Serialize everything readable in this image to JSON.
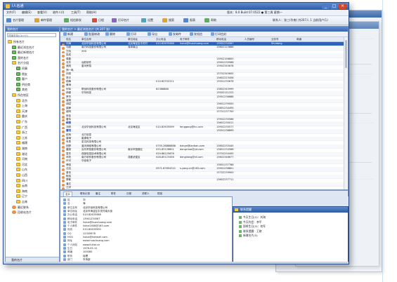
{
  "window": {
    "title": "Ⅰ人名通",
    "controls": {
      "minimize": "_",
      "maximize": "□",
      "close": "×"
    }
  },
  "menu": {
    "items": [
      "文件(F)",
      "编辑(E)",
      "查看(V)",
      "收件人(I)",
      "工具(T)",
      "帮助(H)"
    ],
    "clock": "版本：8.0 Build 07.0522  ● 第三周 星期一"
  },
  "toolbar": {
    "buttons": [
      {
        "label": "名片管理",
        "icon": "card-icon",
        "color": "#4f86d6"
      },
      {
        "label": "邮件管理",
        "icon": "mail-icon",
        "color": "#e0a23a"
      },
      {
        "label": "短信群发",
        "icon": "sms-icon",
        "color": "#5fae5b"
      },
      {
        "label": "日程",
        "icon": "calendar-icon",
        "color": "#d0503d"
      },
      {
        "label": "打印名片",
        "icon": "print-icon",
        "color": "#8a63c2"
      },
      {
        "label": "设置",
        "icon": "settings-icon",
        "color": "#4aa7b7"
      },
      {
        "label": "搜索",
        "icon": "search-icon",
        "color": "#e0a23a"
      },
      {
        "label": "报表",
        "icon": "report-icon",
        "color": "#4f86d6"
      },
      {
        "label": "帮助",
        "icon": "help-icon",
        "color": "#5fae5b"
      }
    ],
    "summary": "联系人：张三(华南) 共207人 1 当前用户(1)"
  },
  "sidebar": {
    "header": "我的名片",
    "filter": "快速查找(Ctrl+F)",
    "tree": [
      {
        "label": "所有名片",
        "level": 0,
        "icon": "folder"
      },
      {
        "label": "最近浏览名片",
        "level": 1,
        "icon": "group"
      },
      {
        "label": "最近新增名片",
        "level": 1,
        "icon": "group"
      },
      {
        "label": "我的名片",
        "level": 1,
        "icon": "group"
      },
      {
        "label": "名片分组",
        "level": 1,
        "icon": "folder"
      },
      {
        "label": "同事",
        "level": 2,
        "icon": "group"
      },
      {
        "label": "朋友",
        "level": 2,
        "icon": "group"
      },
      {
        "label": "客户",
        "level": 2,
        "icon": "group"
      },
      {
        "label": "供应商",
        "level": 2,
        "icon": "group"
      },
      {
        "label": "其他",
        "level": 2,
        "icon": "group"
      },
      {
        "label": "所在地区",
        "level": 1,
        "icon": "folder"
      },
      {
        "label": "北京",
        "level": 2,
        "icon": "folder"
      },
      {
        "label": "上海",
        "level": 2,
        "icon": "folder"
      },
      {
        "label": "天津",
        "level": 2,
        "icon": "folder"
      },
      {
        "label": "重庆",
        "level": 2,
        "icon": "folder"
      },
      {
        "label": "广东",
        "level": 2,
        "icon": "folder"
      },
      {
        "label": "广西",
        "level": 2,
        "icon": "folder"
      },
      {
        "label": "浙江",
        "level": 2,
        "icon": "folder"
      },
      {
        "label": "江苏",
        "level": 2,
        "icon": "folder"
      },
      {
        "label": "福建",
        "level": 2,
        "icon": "folder"
      },
      {
        "label": "湖南",
        "level": 2,
        "icon": "folder"
      },
      {
        "label": "湖北",
        "level": 2,
        "icon": "folder"
      },
      {
        "label": "河南",
        "level": 2,
        "icon": "folder"
      },
      {
        "label": "河北",
        "level": 2,
        "icon": "folder"
      },
      {
        "label": "山东",
        "level": 2,
        "icon": "folder"
      },
      {
        "label": "山西",
        "level": 2,
        "icon": "folder"
      },
      {
        "label": "四川",
        "level": 2,
        "icon": "folder"
      },
      {
        "label": "云南",
        "level": 2,
        "icon": "folder"
      },
      {
        "label": "海南",
        "level": 2,
        "icon": "folder"
      },
      {
        "label": "辽宁",
        "level": 2,
        "icon": "folder"
      },
      {
        "label": "吉林",
        "level": 2,
        "icon": "folder"
      },
      {
        "label": "最近联系",
        "level": 1,
        "icon": "person"
      },
      {
        "label": "回收站名片",
        "level": 1,
        "icon": "person"
      }
    ],
    "footer": "我的名片"
  },
  "list": {
    "header": "我的名片 > 最近浏览名片 (共 207 张)",
    "subtools": [
      "新建",
      "批量修改",
      "删除",
      "打印",
      "导出",
      "发邮件",
      "发短信",
      "打印信封"
    ],
    "columns": [
      "姓名",
      "单位名称",
      "单位地址",
      "办公电话",
      "电子邮件",
      "移动电话",
      "人员编号",
      "业务号",
      "邮编"
    ],
    "rows": [
      {
        "name": "刘海",
        "company": "北京华创科技有限公司",
        "address": "北京海淀区中关村",
        "phone": "010-82635588",
        "email": "liuhai@huachuang.com",
        "mobile": "13901234567",
        "no": "",
        "biz": "Shuitang",
        "zip": "",
        "selected": true
      },
      {
        "name": "马超",
        "company": "南方科技股份有限公司",
        "address": "深圳南山",
        "phone": "",
        "email": "",
        "mobile": "13602123888",
        "no": "",
        "biz": "",
        "zip": ""
      },
      {
        "name": "王晓",
        "company": "XXX",
        "address": "",
        "phone": "",
        "email": "",
        "mobile": "",
        "no": "",
        "biz": "",
        "zip": ""
      },
      {
        "name": "张成",
        "company": "",
        "address": "",
        "phone": "",
        "email": "",
        "mobile": "",
        "no": "",
        "biz": "",
        "zip": ""
      },
      {
        "name": "周磊",
        "company": "",
        "address": "",
        "phone": "",
        "email": "",
        "mobile": "13902156800",
        "no": "",
        "biz": "",
        "zip": ""
      },
      {
        "name": "韦东",
        "company": "远航软件",
        "address": "",
        "phone": "",
        "email": "",
        "mobile": "13901235566",
        "no": "",
        "biz": "",
        "zip": ""
      },
      {
        "name": "吴刚",
        "company": "星河贸易",
        "address": "",
        "phone": "",
        "email": "",
        "mobile": "13902345678",
        "no": "",
        "biz": "",
        "zip": ""
      },
      {
        "name": "郑一鸣",
        "company": "",
        "address": "",
        "phone": "",
        "email": "",
        "mobile": "",
        "no": "",
        "biz": "",
        "zip": ""
      },
      {
        "name": "孙丽",
        "company": "",
        "address": "",
        "phone": "",
        "email": "",
        "mobile": "13702345600",
        "no": "",
        "biz": "",
        "zip": ""
      },
      {
        "name": "李平",
        "company": "",
        "address": "",
        "phone": "",
        "email": "",
        "mobile": "13602223456",
        "no": "",
        "biz": "",
        "zip": ""
      },
      {
        "name": "杨梅",
        "company": "",
        "address": "",
        "phone": "010-62332211",
        "email": "",
        "mobile": "13501235678",
        "no": "",
        "biz": "",
        "zip": ""
      },
      {
        "name": "黄涛",
        "company": "",
        "address": "",
        "phone": "",
        "email": "",
        "mobile": "",
        "no": "",
        "biz": "",
        "zip": ""
      },
      {
        "name": "何军",
        "company": "联创科技股份有限公司",
        "address": "",
        "phone": "62388888",
        "email": "",
        "mobile": "13802345999",
        "no": "",
        "biz": "",
        "zip": ""
      },
      {
        "name": "林峰",
        "company": "华东科技",
        "address": "",
        "phone": "",
        "email": "",
        "mobile": "13502111222",
        "no": "",
        "biz": "",
        "zip": ""
      },
      {
        "name": "罗杰",
        "company": "",
        "address": "",
        "phone": "",
        "email": "",
        "mobile": "13901236688",
        "no": "",
        "biz": "",
        "zip": ""
      },
      {
        "name": "高翔",
        "company": "",
        "address": "",
        "phone": "",
        "email": "",
        "mobile": "",
        "no": "",
        "biz": "",
        "zip": ""
      },
      {
        "name": "胡斌",
        "company": "",
        "address": "",
        "phone": "",
        "email": "",
        "mobile": "13601239000",
        "no": "",
        "biz": "",
        "zip": ""
      },
      {
        "name": "梁静",
        "company": "",
        "address": "",
        "phone": "",
        "email": "",
        "mobile": "13801234455",
        "no": "",
        "biz": "",
        "zip": ""
      },
      {
        "name": "谢明",
        "company": "",
        "address": "",
        "phone": "",
        "email": "",
        "mobile": "13701237700",
        "no": "",
        "biz": "",
        "zip": ""
      },
      {
        "name": "宋佳",
        "company": "",
        "address": "",
        "phone": "",
        "email": "",
        "mobile": "",
        "no": "",
        "biz": "",
        "zip": ""
      },
      {
        "name": "唐伟",
        "company": "",
        "address": "",
        "phone": "",
        "email": "",
        "mobile": "13902235566",
        "no": "",
        "biz": "",
        "zip": ""
      },
      {
        "name": "韩雪",
        "company": "",
        "address": "",
        "phone": "",
        "email": "",
        "mobile": "13601230011",
        "no": "",
        "biz": "",
        "zip": "",
        "highlight": true
      },
      {
        "name": "冯刚",
        "company": "北京华创科技有限公司",
        "address": "北京海淀区",
        "phone": "010-82635599",
        "email": "fenggang@hc.com",
        "mobile": "13902235577",
        "no": "",
        "biz": "",
        "zip": ""
      },
      {
        "name": "曹阳",
        "company": "",
        "address": "",
        "phone": "",
        "email": "",
        "mobile": "13501238899",
        "no": "",
        "biz": "",
        "zip": "",
        "highlight": true
      },
      {
        "name": "彭辉",
        "company": "北方信息",
        "address": "",
        "phone": "",
        "email": "",
        "mobile": "",
        "no": "",
        "biz": "",
        "zip": ""
      },
      {
        "name": "曾琳",
        "company": "星源电子",
        "address": "",
        "phone": "",
        "email": "",
        "mobile": "",
        "no": "",
        "biz": "",
        "zip": ""
      },
      {
        "name": "肖勇",
        "company": "宏达科技有限公司",
        "address": "",
        "phone": "",
        "email": "",
        "mobile": "",
        "no": "",
        "biz": "",
        "zip": ""
      },
      {
        "name": "田野",
        "company": "蓝天网络有限公司",
        "address": "",
        "phone": "0755-26888888",
        "email": "tianye@lantian.com",
        "mobile": "13802233445",
        "no": "",
        "biz": "",
        "zip": ""
      },
      {
        "name": "董超",
        "company": "远东贸易股份有限公司",
        "address": "南京市鼓楼区",
        "phone": "025-83128801",
        "email": "dongchao@yd.com",
        "mobile": "13801234566",
        "no": "",
        "biz": "",
        "zip": ""
      },
      {
        "name": "袁芳",
        "company": "西部信息技术有限公司",
        "address": "",
        "phone": "029-88125678",
        "email": "",
        "mobile": "13702234455",
        "no": "",
        "biz": "",
        "zip": ""
      },
      {
        "name": "邓亮",
        "company": "南方软件股份有限公司",
        "address": "成都武侯区",
        "phone": "028-85123456",
        "email": "dengliang@nf.com",
        "mobile": "13602346677",
        "no": "",
        "biz": "",
        "zip": ""
      },
      {
        "name": "许可",
        "company": "华信电子",
        "address": "",
        "phone": "",
        "email": "",
        "mobile": "",
        "no": "",
        "biz": "",
        "zip": ""
      },
      {
        "name": "傅强",
        "company": "",
        "address": "",
        "phone": "",
        "email": "",
        "mobile": "13801237788",
        "no": "",
        "biz": "",
        "zip": ""
      },
      {
        "name": "沈洁",
        "company": "",
        "address": "",
        "phone": "0571-87654321",
        "email": "s.yang.cn@163.com",
        "mobile": "13901238801",
        "no": "",
        "biz": "",
        "zip": ""
      },
      {
        "name": "曾伟",
        "company": "",
        "address": "",
        "phone": "",
        "email": "",
        "mobile": "13702239900",
        "no": "",
        "biz": "",
        "zip": ""
      },
      {
        "name": "程浩",
        "company": "",
        "address": "",
        "phone": "",
        "email": "",
        "mobile": "",
        "no": "",
        "biz": "",
        "zip": ""
      },
      {
        "name": "蔡敏",
        "company": "",
        "address": "",
        "phone": "",
        "email": "",
        "mobile": "13602237711",
        "no": "",
        "biz": "",
        "zip": ""
      },
      {
        "name": "潘文",
        "company": "",
        "address": "",
        "phone": "",
        "email": "",
        "mobile": "",
        "no": "",
        "biz": "",
        "zip": ""
      },
      {
        "name": "汪洋",
        "company": "",
        "address": "",
        "phone": "",
        "email": "",
        "mobile": "",
        "no": "",
        "biz": "",
        "zip": ""
      }
    ]
  },
  "detail": {
    "tabs": [
      "名片",
      "联系记录",
      "备注",
      "附件",
      "日程",
      "关联人",
      "短信"
    ],
    "fields": [
      {
        "k": "姓",
        "v": "刘"
      },
      {
        "k": "名",
        "v": "海"
      },
      {
        "k": "单位名称",
        "v": "北京华创科技有限公司"
      },
      {
        "k": "单位地址",
        "v": "北京市海淀区中关村南大街"
      },
      {
        "k": "办公电话",
        "v": "010-82635588"
      },
      {
        "k": "移动电话",
        "v": "13901234567"
      },
      {
        "k": "电子邮件",
        "v": "liuhai@huachuang.com"
      },
      {
        "k": "个人邮件",
        "v": "liuhai2008@163.com"
      },
      {
        "k": "传真",
        "v": "010-82635500"
      },
      {
        "k": "QQ",
        "v": "12345678"
      },
      {
        "k": "MSN",
        "v": "liuhai@hotmail.com"
      },
      {
        "k": "网址",
        "v": "www.huachuang.com"
      },
      {
        "k": "个人网站",
        "v": "www.liuhai.cn"
      },
      {
        "k": "生日",
        "v": "1978-05-12"
      },
      {
        "k": "邮编",
        "v": "100080"
      },
      {
        "k": "职务",
        "v": "经理"
      },
      {
        "k": "部门",
        "v": "市场部"
      }
    ]
  },
  "popup": {
    "title": "联系提醒",
    "items": [
      "今天生日(2)：刘海",
      "今天约会：李平",
      "即将生日(3)：何军",
      "联系提醒：王晓",
      "新增名片(5)"
    ]
  }
}
